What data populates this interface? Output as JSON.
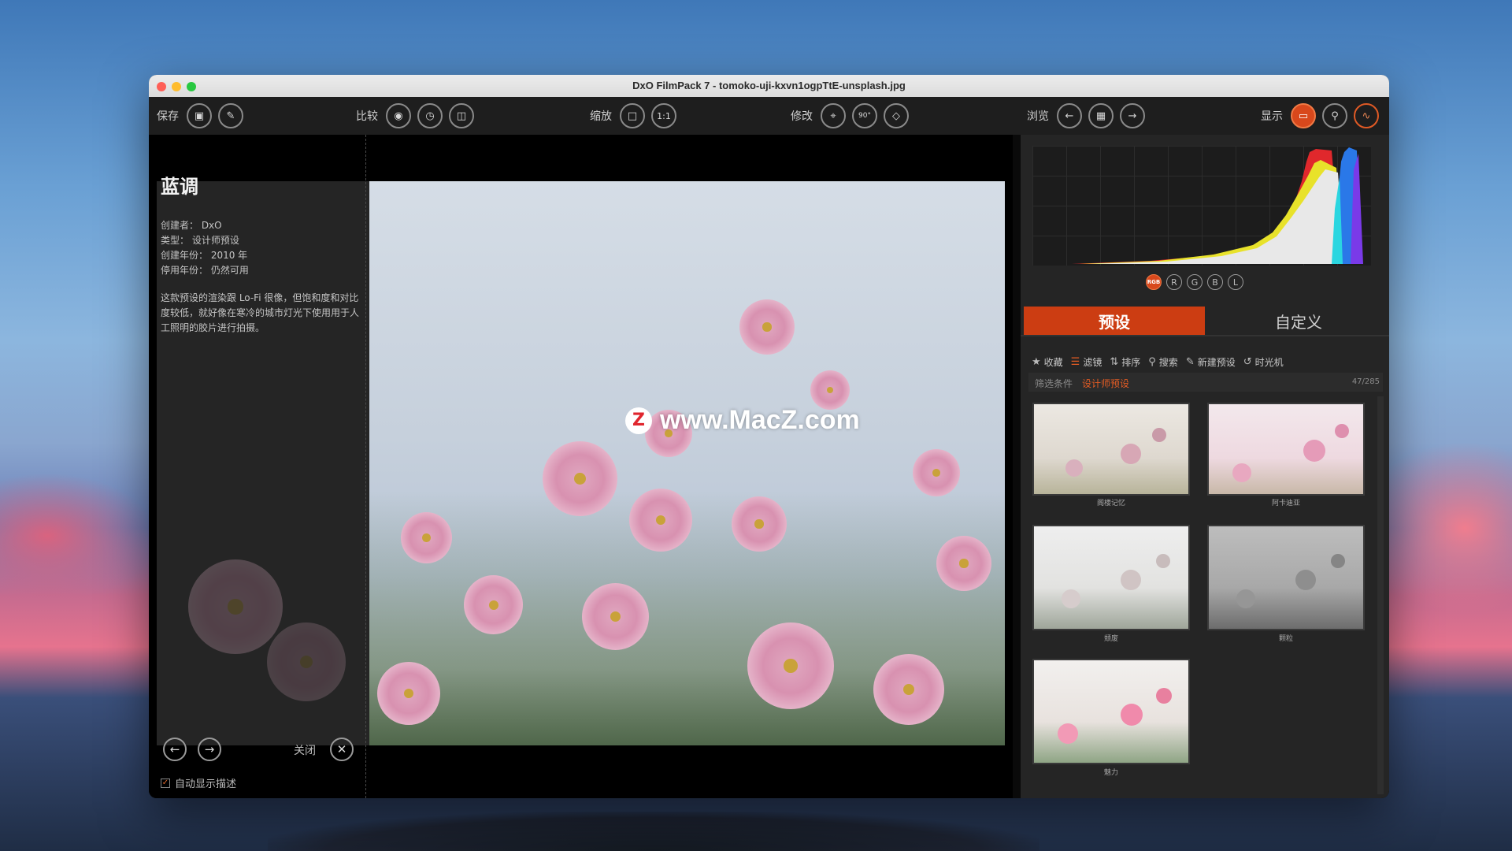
{
  "window": {
    "title": "DxO FilmPack 7 - tomoko-uji-kxvn1ogpTtE-unsplash.jpg"
  },
  "toolbar": {
    "save_label": "保存",
    "compare_label": "比较",
    "zoom_label": "缩放",
    "zoom_1to1": "1:1",
    "edit_label": "修改",
    "rotate_label": "90°",
    "browse_label": "浏览",
    "display_label": "显示"
  },
  "description": {
    "title": "蓝调",
    "creator": "创建者： DxO",
    "type": "类型： 设计师预设",
    "created_year": "创建年份： 2010 年",
    "discontinued": "停用年份： 仍然可用",
    "body": "这款预设的渲染跟 Lo-Fi 很像，但饱和度和对比度较低，就好像在寒冷的城市灯光下使用用于人工照明的胶片进行拍摄。",
    "close_label": "关闭",
    "auto_show_label": "自动显示描述",
    "auto_show_checked": true
  },
  "watermark": {
    "logo": "Z",
    "text": "www.MacZ.com"
  },
  "histogram": {
    "channels": [
      "RGB",
      "R",
      "G",
      "B",
      "L"
    ],
    "active_channel": "RGB"
  },
  "presets_panel": {
    "tabs": [
      "预设",
      "自定义"
    ],
    "active_tab": "预设",
    "actions": [
      {
        "label": "收藏",
        "icon": "star-icon"
      },
      {
        "label": "滤镜",
        "icon": "list-filter-icon"
      },
      {
        "label": "排序",
        "icon": "sort-icon"
      },
      {
        "label": "搜索",
        "icon": "search-icon"
      },
      {
        "label": "新建预设",
        "icon": "new-preset-icon"
      },
      {
        "label": "时光机",
        "icon": "time-machine-icon"
      }
    ],
    "filter_label": "筛选条件",
    "filter_value": "设计师预设",
    "count": "47/285",
    "thumbnails": [
      {
        "label": "阁楼记忆",
        "tone": "warm"
      },
      {
        "label": "阿卡迪亚",
        "tone": "pink"
      },
      {
        "label": "颓废",
        "tone": "faded"
      },
      {
        "label": "颗粒",
        "tone": "mono"
      },
      {
        "label": "魅力",
        "tone": "vivid"
      }
    ]
  },
  "colors": {
    "accent": "#cc3d12",
    "toolbar_bg": "#1e1e1e",
    "panel_bg": "#252525"
  }
}
